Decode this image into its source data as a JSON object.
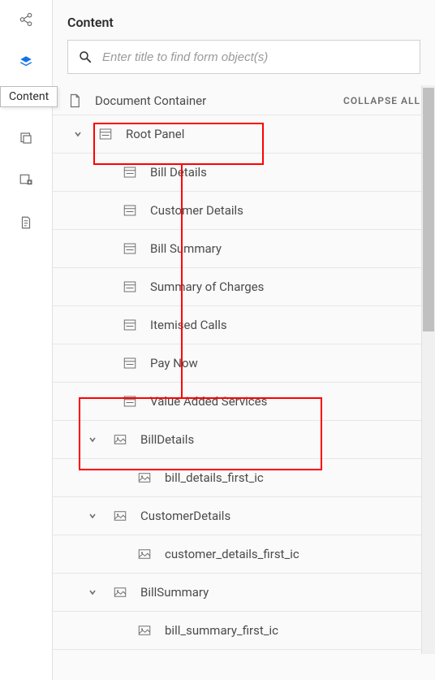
{
  "header": {
    "title": "Content"
  },
  "search": {
    "placeholder": "Enter title to find form object(s)"
  },
  "tooltip": "Content",
  "collapse_all": "COLLAPSE ALL",
  "document_container": "Document Container",
  "tree": [
    {
      "label": "Root Panel",
      "indent": 18,
      "chevron": true,
      "iconType": "panel"
    },
    {
      "label": "Bill Details",
      "indent": 48,
      "chevron": false,
      "iconType": "panel"
    },
    {
      "label": "Customer Details",
      "indent": 48,
      "chevron": false,
      "iconType": "panel"
    },
    {
      "label": "Bill Summary",
      "indent": 48,
      "chevron": false,
      "iconType": "panel"
    },
    {
      "label": "Summary of Charges",
      "indent": 48,
      "chevron": false,
      "iconType": "panel"
    },
    {
      "label": "Itemised Calls",
      "indent": 48,
      "chevron": false,
      "iconType": "panel"
    },
    {
      "label": "Pay Now",
      "indent": 48,
      "chevron": false,
      "iconType": "panel"
    },
    {
      "label": "Value Added Services",
      "indent": 48,
      "chevron": false,
      "iconType": "panel"
    },
    {
      "label": "BillDetails",
      "indent": 36,
      "chevron": true,
      "iconType": "image"
    },
    {
      "label": "bill_details_first_ic",
      "indent": 66,
      "chevron": false,
      "iconType": "image"
    },
    {
      "label": "CustomerDetails",
      "indent": 36,
      "chevron": true,
      "iconType": "image"
    },
    {
      "label": "customer_details_first_ic",
      "indent": 66,
      "chevron": false,
      "iconType": "image"
    },
    {
      "label": "BillSummary",
      "indent": 36,
      "chevron": true,
      "iconType": "image"
    },
    {
      "label": "bill_summary_first_ic",
      "indent": 66,
      "chevron": false,
      "iconType": "image"
    }
  ]
}
